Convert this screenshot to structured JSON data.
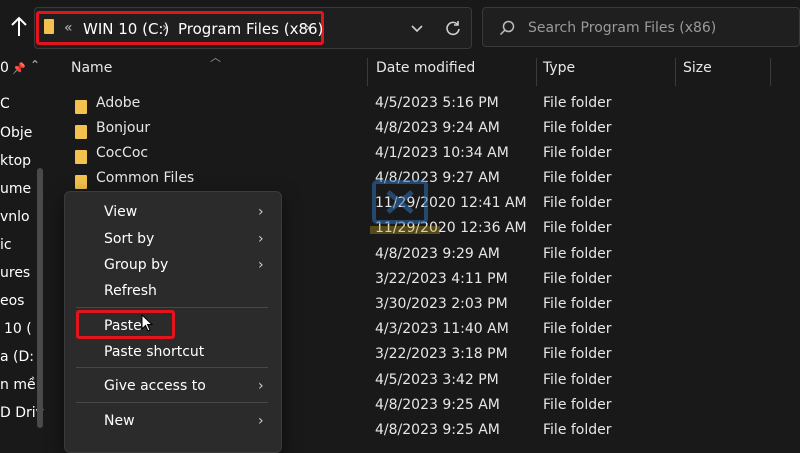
{
  "address": {
    "crumbs": [
      "WIN 10 (C:)",
      "Program Files (x86)"
    ],
    "overflow": "«"
  },
  "search": {
    "placeholder": "Search Program Files (x86)"
  },
  "nav": {
    "items": [
      "0",
      "C",
      "Obje",
      "ktop",
      "ume",
      "vnlo",
      "ic",
      "ures",
      "eos",
      "10 (",
      "a (D:",
      "n mề",
      "D Driv"
    ]
  },
  "columns": {
    "name": "Name",
    "date": "Date modified",
    "type": "Type",
    "size": "Size"
  },
  "rows": [
    {
      "name": "Adobe",
      "date": "4/5/2023 5:16 PM",
      "type": "File folder"
    },
    {
      "name": "Bonjour",
      "date": "4/8/2023 9:24 AM",
      "type": "File folder"
    },
    {
      "name": "CocCoc",
      "date": "4/1/2023 10:34 AM",
      "type": "File folder"
    },
    {
      "name": "Common Files",
      "date": "4/8/2023 9:27 AM",
      "type": "File folder"
    },
    {
      "name": "",
      "date": "11/29/2020 12:41 AM",
      "type": "File folder"
    },
    {
      "name": "",
      "date": "11/29/2020 12:36 AM",
      "type": "File folder"
    },
    {
      "name": "",
      "date": "4/8/2023 9:29 AM",
      "type": "File folder"
    },
    {
      "name": "",
      "date": "3/22/2023 4:11 PM",
      "type": "File folder"
    },
    {
      "name": "",
      "date": "3/30/2023 2:03 PM",
      "type": "File folder"
    },
    {
      "name": "",
      "date": "4/3/2023 11:40 AM",
      "type": "File folder"
    },
    {
      "name": "",
      "date": "3/22/2023 3:18 PM",
      "type": "File folder"
    },
    {
      "name": "",
      "date": "4/5/2023 3:42 PM",
      "type": "File folder"
    },
    {
      "name": "",
      "date": "4/8/2023 9:25 AM",
      "type": "File folder"
    },
    {
      "name": "",
      "date": "4/8/2023 9:25 AM",
      "type": "File folder"
    }
  ],
  "menu": {
    "view": "View",
    "sort_by": "Sort by",
    "group_by": "Group by",
    "refresh": "Refresh",
    "paste": "Paste",
    "paste_shortcut": "Paste shortcut",
    "give_access": "Give access to",
    "new": "New"
  },
  "colors": {
    "highlight": "#e3141c",
    "folder": "#f2c14e",
    "background": "#191919"
  }
}
